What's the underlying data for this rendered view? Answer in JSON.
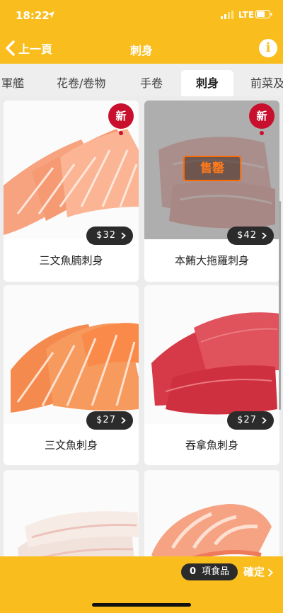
{
  "status_bar": {
    "time": "18:22",
    "network": "LTE"
  },
  "nav": {
    "back_label": "上一頁",
    "title": "刺身",
    "info_label": "i"
  },
  "tabs": [
    {
      "label": "軍艦",
      "active": false
    },
    {
      "label": "花卷/卷物",
      "active": false
    },
    {
      "label": "手卷",
      "active": false
    },
    {
      "label": "刺身",
      "active": true
    },
    {
      "label": "前菜及"
    }
  ],
  "products": [
    {
      "name": "三文魚腩刺身",
      "price": "$32",
      "is_new": true,
      "badge": "新",
      "sold_out": false
    },
    {
      "name": "本鮪大拖羅刺身",
      "price": "$42",
      "is_new": true,
      "badge": "新",
      "sold_out": true,
      "sold_out_label": "售罄"
    },
    {
      "name": "三文魚刺身",
      "price": "$27",
      "is_new": false,
      "sold_out": false
    },
    {
      "name": "吞拿魚刺身",
      "price": "$27",
      "is_new": false,
      "sold_out": false
    },
    {
      "name": "",
      "price": "",
      "is_new": false,
      "sold_out": false
    },
    {
      "name": "",
      "price": "",
      "is_new": false,
      "sold_out": false
    }
  ],
  "cart": {
    "count": "0",
    "label": "項食品",
    "confirm_label": "確定"
  },
  "colors": {
    "brand_yellow": "#f9bd1d",
    "new_badge_red": "#c8102e",
    "pill_dark": "#2b2b2b",
    "sold_out_orange": "#ff6a00"
  },
  "icons": {
    "back": "chevron-left-icon",
    "info": "info-icon",
    "price_chevron": "chevron-right-icon",
    "confirm_chevron": "chevron-right-icon"
  }
}
